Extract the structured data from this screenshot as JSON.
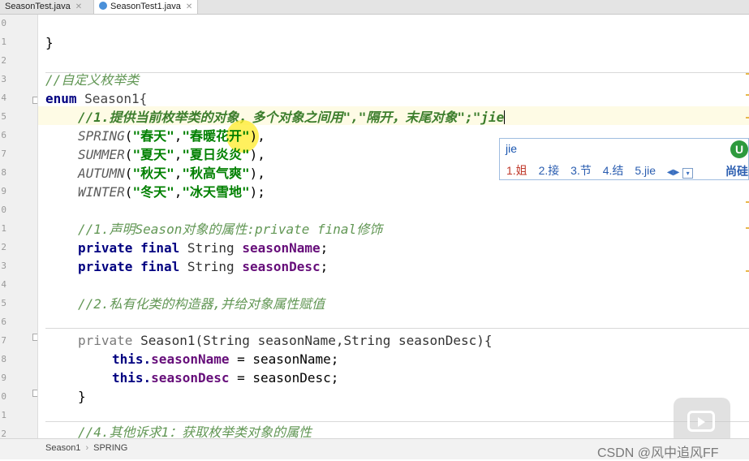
{
  "tabs": [
    {
      "label": "SeasonTest.java",
      "active": false
    },
    {
      "label": "SeasonTest1.java",
      "active": true
    }
  ],
  "gutter_numbers": [
    "0",
    "1",
    "2",
    "3",
    "4",
    "5",
    "6",
    "7",
    "8",
    "9",
    "0",
    "1",
    "2",
    "3",
    "4",
    "5",
    "6",
    "7",
    "8",
    "9",
    "0",
    "1",
    "2",
    "3"
  ],
  "code": {
    "closing_brace": "}",
    "comment_enum": "//自定义枚举类",
    "enum_kw": "enum",
    "enum_name": "Season1{",
    "comment_1": "//1.提供当前枚举类的对象，多个对象之间用\",\"隔开，末尾对象\";\"jie",
    "spring": {
      "name": "SPRING",
      "open": "(",
      "a": "\"春天\"",
      "comma": ",",
      "b": "\"春暖花开\"",
      "end": "),"
    },
    "summer": {
      "name": "SUMMER",
      "open": "(",
      "a": "\"夏天\"",
      "comma": ",",
      "b": "\"夏日炎炎\"",
      "end": "),"
    },
    "autumn": {
      "name": "AUTUMN",
      "open": "(",
      "a": "\"秋天\"",
      "comma": ",",
      "b": "\"秋高气爽\"",
      "end": "),"
    },
    "winter": {
      "name": "WINTER",
      "open": "(",
      "a": "\"冬天\"",
      "comma": ",",
      "b": "\"冰天雪地\"",
      "end": ");"
    },
    "comment_2": "//1.声明Season对象的属性:private final修饰",
    "private_kw": "private",
    "final_kw": "final",
    "string_type": "String",
    "field_name": "seasonName",
    "field_desc": "seasonDesc",
    "semicolon": ";",
    "comment_3": "//2.私有化类的构造器,并给对象属性赋值",
    "ctor_sig": "Season1(String seasonName,String seasonDesc){",
    "this_kw": "this.",
    "assign_name": " = seasonName;",
    "assign_desc": " = seasonDesc;",
    "close_ctor": "}",
    "comment_4": "//4.其他诉求1：获取枚举类对象的属性"
  },
  "ime": {
    "composition": "jie",
    "candidates": [
      "1.姐",
      "2.接",
      "3.节",
      "4.结",
      "5.jie"
    ],
    "nav_prev": "◀",
    "nav_next": "▶",
    "nav_more": "▾",
    "logo": "U",
    "brand": "尚硅"
  },
  "breadcrumb": [
    "Season1",
    "SPRING"
  ],
  "breadcrumb_sep": "›",
  "watermark": "CSDN @风中追风FF",
  "colors": {
    "comment": "#629755",
    "keyword": "#000080",
    "string": "#008000",
    "field": "#660e7a"
  }
}
